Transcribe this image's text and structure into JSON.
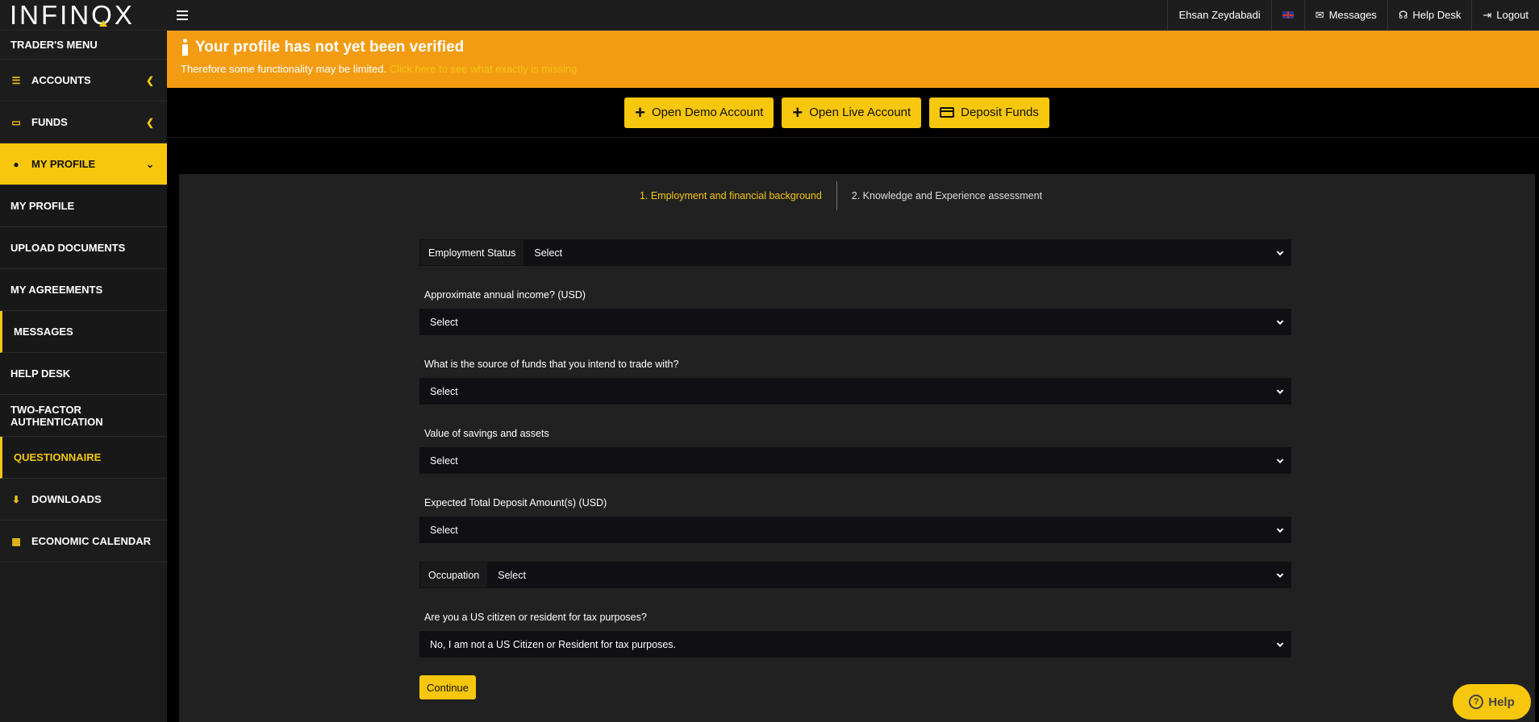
{
  "header": {
    "logo": "INFINOX",
    "user_name": "Ehsan Zeydabadi",
    "messages_label": "Messages",
    "helpdesk_label": "Help Desk",
    "logout_label": "Logout"
  },
  "sidebar": {
    "heading": "TRADER'S MENU",
    "items": [
      {
        "label": "ACCOUNTS"
      },
      {
        "label": "FUNDS"
      },
      {
        "label": "MY PROFILE"
      }
    ],
    "sub_items": [
      {
        "label": "MY PROFILE"
      },
      {
        "label": "UPLOAD DOCUMENTS"
      },
      {
        "label": "MY AGREEMENTS"
      },
      {
        "label": "MESSAGES"
      },
      {
        "label": "HELP DESK"
      },
      {
        "label": "TWO-FACTOR AUTHENTICATION"
      },
      {
        "label": "QUESTIONNAIRE"
      }
    ],
    "bottom_items": [
      {
        "label": "DOWNLOADS"
      },
      {
        "label": "ECONOMIC CALENDAR"
      }
    ]
  },
  "banner": {
    "title": "Your profile has not yet been verified",
    "text": "Therefore some functionality may be limited.",
    "link": "Click here to see what exactly is missing"
  },
  "actions": {
    "demo": "Open Demo Account",
    "live": "Open Live Account",
    "deposit": "Deposit Funds"
  },
  "steps": {
    "step1": "1.  Employment and financial background",
    "step2": "2. Knowledge and Experience assessment"
  },
  "form": {
    "employment_label": "Employment Status",
    "employment_value": "Select",
    "income_label": "Approximate annual income? (USD)",
    "income_value": "Select",
    "source_label": "What is the source of funds that you intend to trade with?",
    "source_value": "Select",
    "savings_label": "Value of savings and assets",
    "savings_value": "Select",
    "deposit_label": "Expected Total Deposit Amount(s) (USD)",
    "deposit_value": "Select",
    "occupation_label": "Occupation",
    "occupation_value": "Select",
    "us_label": "Are you a US citizen or resident for tax purposes?",
    "us_value": "No, I am not a US Citizen or Resident for tax purposes.",
    "continue": "Continue"
  },
  "help_button": "Help",
  "colors": {
    "accent": "#f7c70d",
    "banner": "#f39c12"
  }
}
